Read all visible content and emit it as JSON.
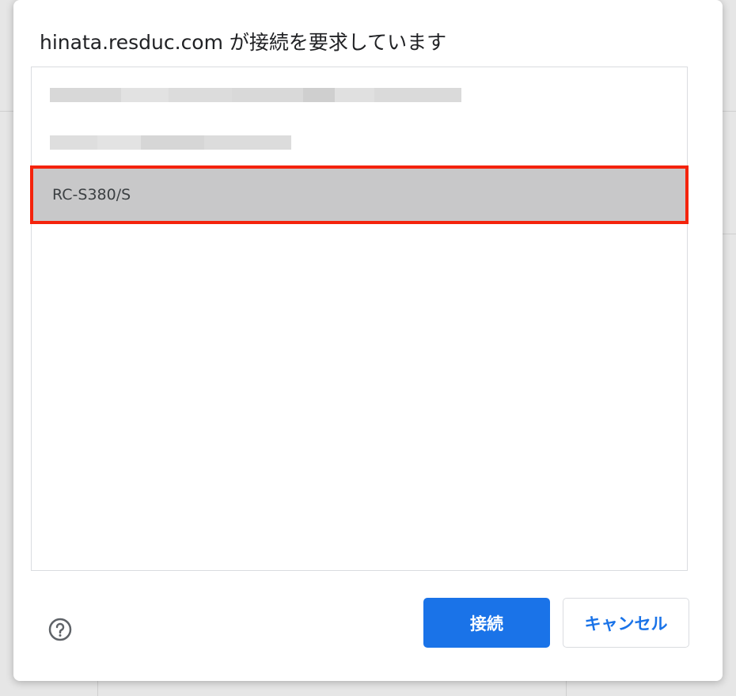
{
  "dialog": {
    "title": "hinata.resduc.com が接続を要求しています",
    "devices": [
      {
        "label": "",
        "blurred": true
      },
      {
        "label": "",
        "blurred": true
      },
      {
        "label": "RC-S380/S",
        "blurred": false,
        "selected": true
      }
    ],
    "connect_label": "接続",
    "cancel_label": "キャンセル",
    "help_icon": "help-circle-icon"
  },
  "colors": {
    "accent": "#1a73e8",
    "highlight_border": "#f4230c",
    "selected_row": "#c8c8c9"
  }
}
